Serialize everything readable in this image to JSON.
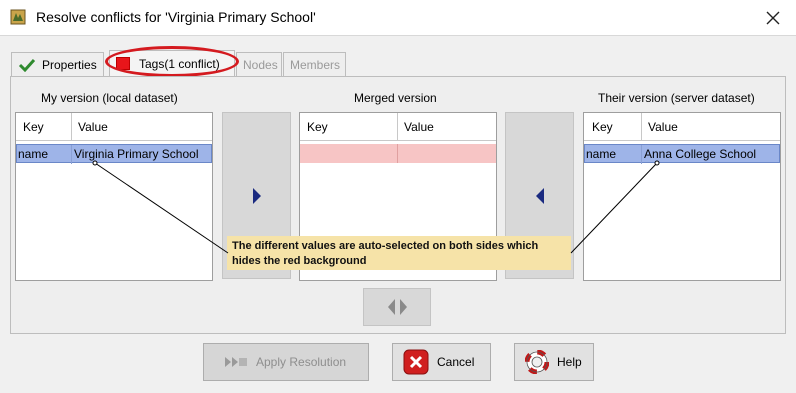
{
  "window": {
    "title": "Resolve conflicts for 'Virginia Primary School'",
    "app_icon": "josm-icon",
    "close_icon": "close-icon"
  },
  "tabs": [
    {
      "label": "Properties",
      "icon": "checkmark-icon",
      "state": "normal"
    },
    {
      "label": "Tags(1 conflict)",
      "icon": "red-square-icon",
      "state": "active",
      "highlighted": true
    },
    {
      "label": "Nodes",
      "state": "disabled"
    },
    {
      "label": "Members",
      "state": "disabled"
    }
  ],
  "my_version": {
    "title": "My version (local dataset)",
    "columns": [
      "Key",
      "Value"
    ],
    "rows": [
      [
        "name",
        "Virginia Primary School"
      ]
    ]
  },
  "merged_version": {
    "title": "Merged version",
    "columns": [
      "Key",
      "Value"
    ],
    "rows": [
      [
        "",
        ""
      ]
    ]
  },
  "their_version": {
    "title": "Their version (server dataset)",
    "columns": [
      "Key",
      "Value"
    ],
    "rows": [
      [
        "name",
        "Anna College School"
      ]
    ]
  },
  "annotation": {
    "text": "The different values are auto-selected on both sides which hides the red background"
  },
  "buttons": {
    "apply": "Apply Resolution",
    "cancel": "Cancel",
    "help": "Help"
  },
  "colors": {
    "selected_row": "#9eb4e8",
    "conflict_row": "#f7c5c5",
    "highlight_ellipse": "#d41a1f",
    "annotation_bg": "#f6e3a8",
    "arrow": "#1a2a80"
  }
}
